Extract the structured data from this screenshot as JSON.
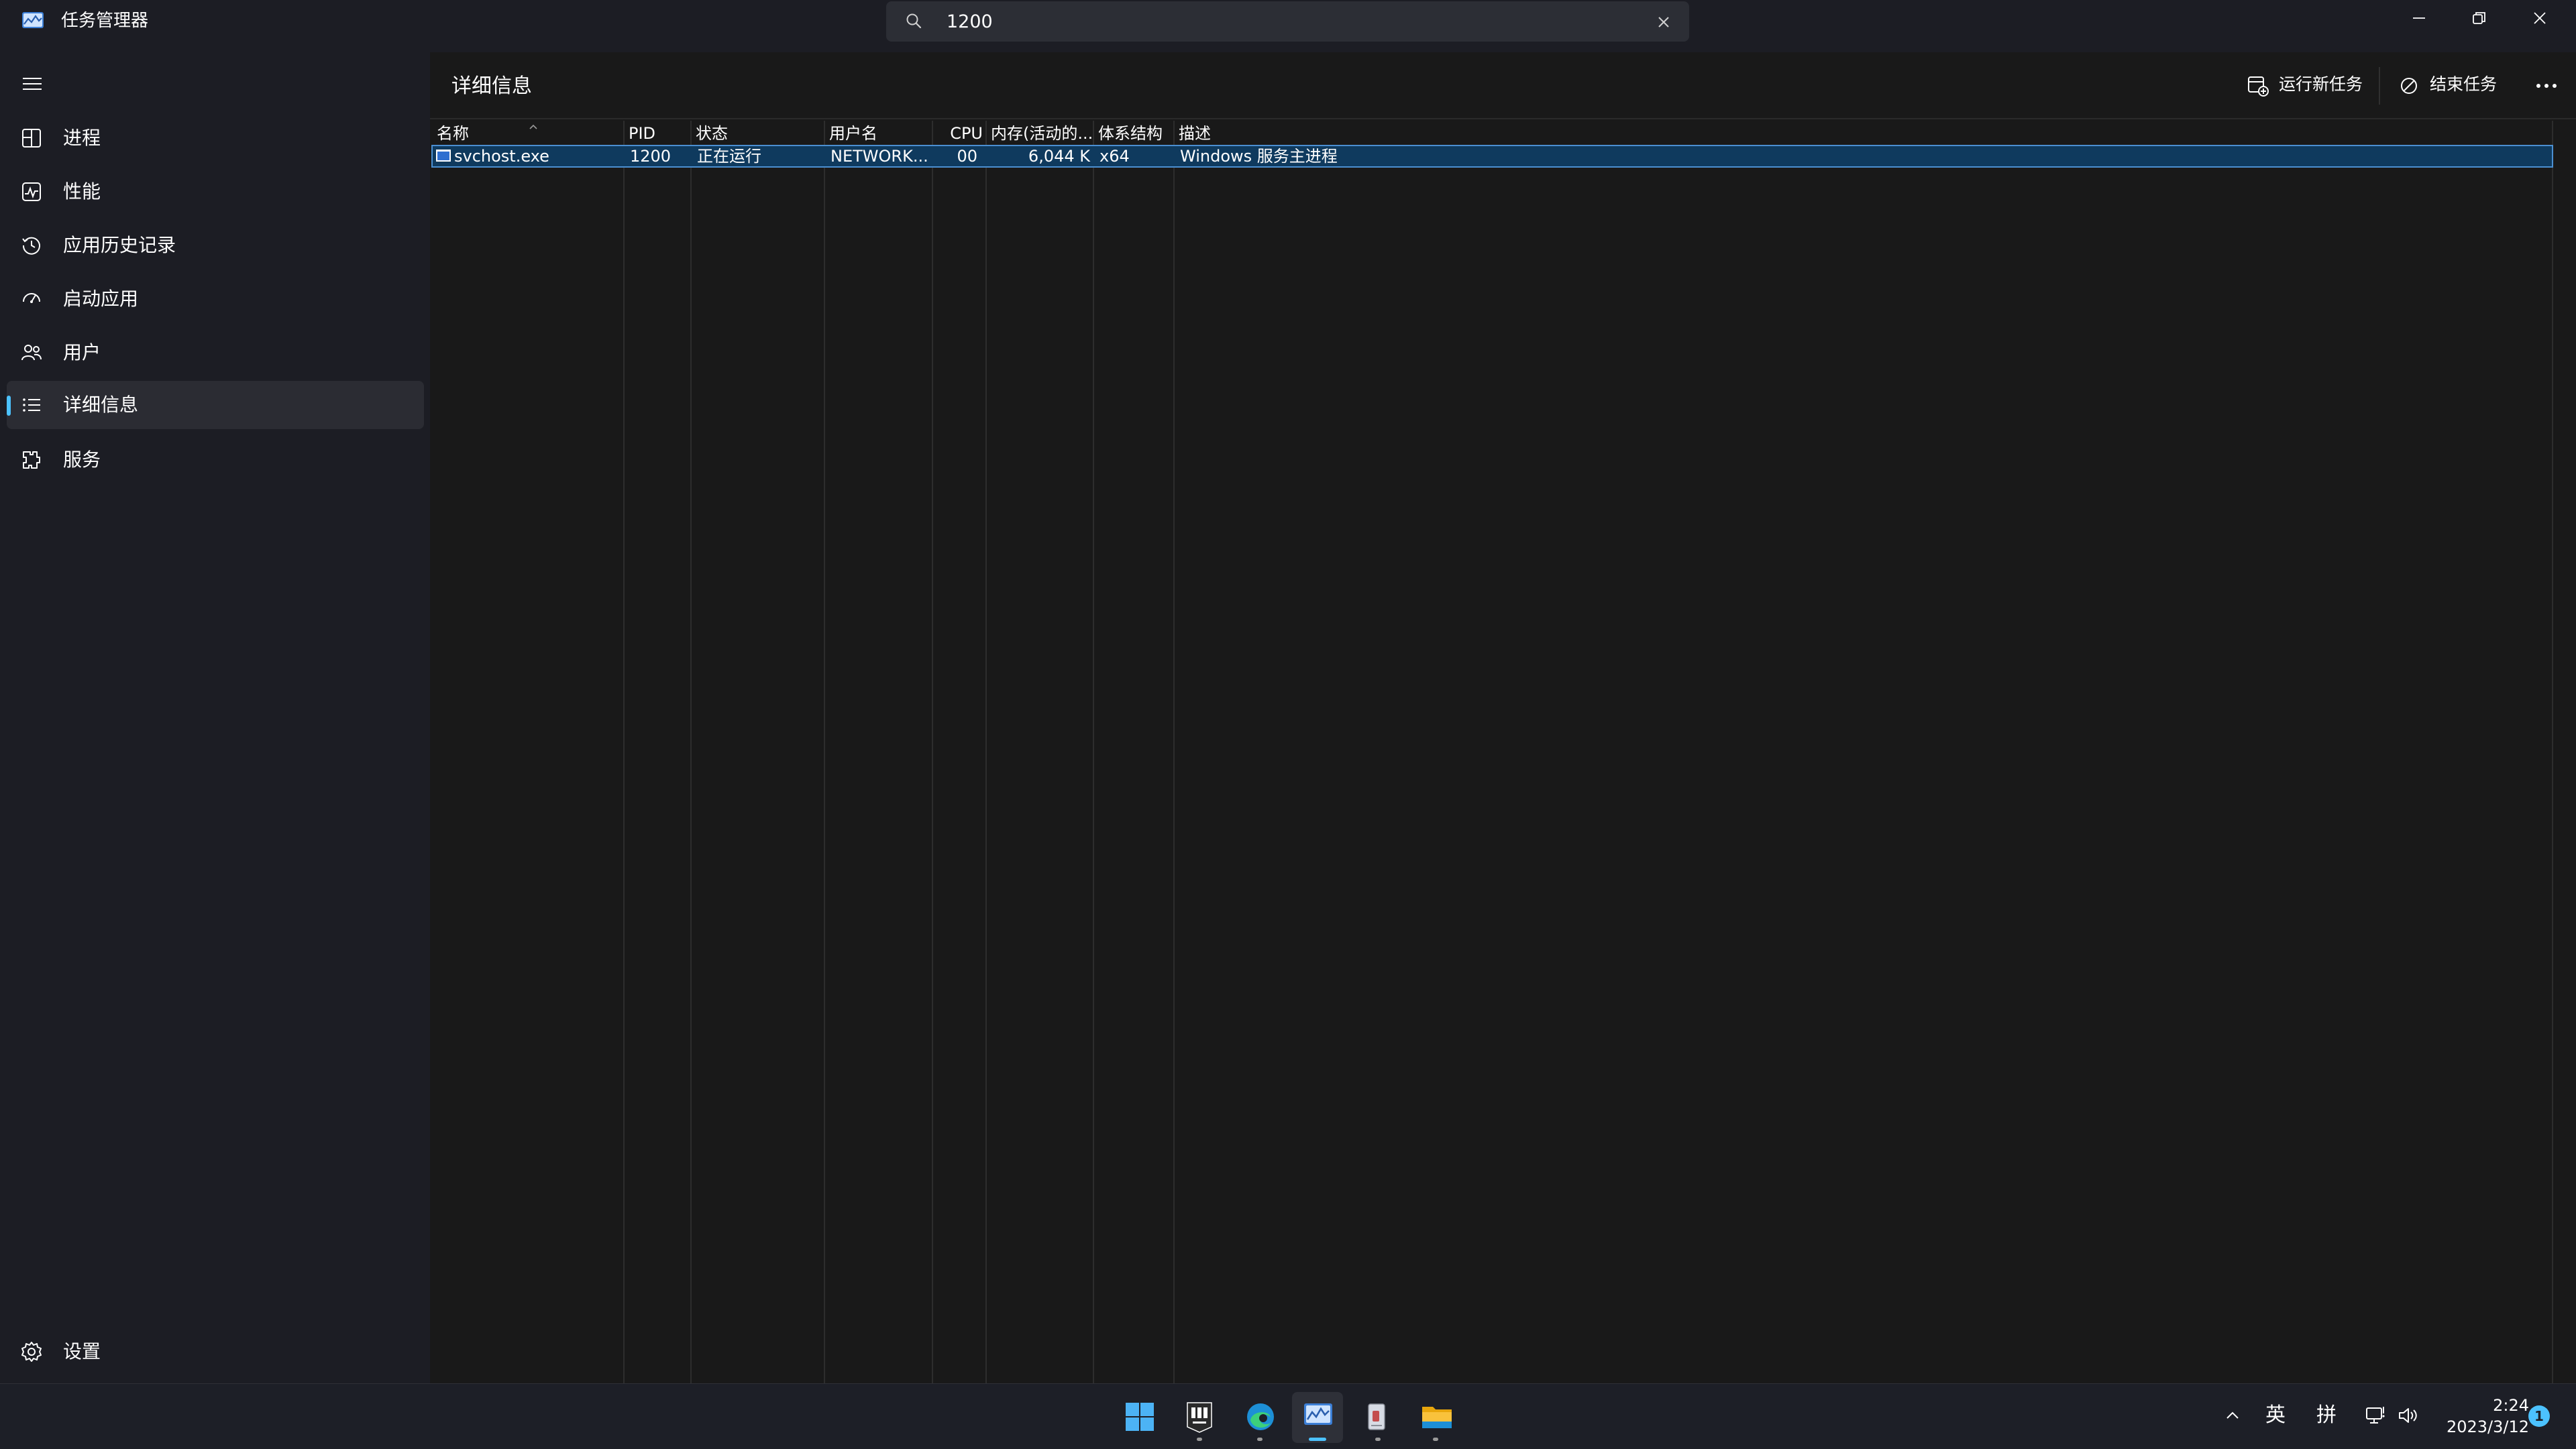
{
  "window": {
    "title": "任务管理器",
    "search": {
      "value": "1200",
      "placeholder": ""
    }
  },
  "sidebar": {
    "items": [
      {
        "label": "进程",
        "icon": "processes-icon",
        "active": false
      },
      {
        "label": "性能",
        "icon": "performance-icon",
        "active": false
      },
      {
        "label": "应用历史记录",
        "icon": "app-history-icon",
        "active": false
      },
      {
        "label": "启动应用",
        "icon": "startup-apps-icon",
        "active": false
      },
      {
        "label": "用户",
        "icon": "users-icon",
        "active": false
      },
      {
        "label": "详细信息",
        "icon": "details-icon",
        "active": true
      },
      {
        "label": "服务",
        "icon": "services-icon",
        "active": false
      }
    ],
    "settings_label": "设置"
  },
  "main": {
    "title": "详细信息",
    "commands": {
      "run_new_task": "运行新任务",
      "end_task": "结束任务"
    },
    "table": {
      "columns": [
        "名称",
        "PID",
        "状态",
        "用户名",
        "CPU",
        "内存(活动的...",
        "体系结构",
        "描述"
      ],
      "sorted_column": "名称",
      "rows": [
        {
          "name": "svchost.exe",
          "pid": "1200",
          "status": "正在运行",
          "user": "NETWORK...",
          "cpu": "00",
          "memory": "6,044 K",
          "arch": "x64",
          "description": "Windows 服务主进程"
        }
      ]
    }
  },
  "taskbar": {
    "apps": [
      "start-icon",
      "epic-games-icon",
      "edge-icon",
      "task-manager-icon",
      "notepad-icon",
      "file-explorer-icon"
    ],
    "active_app": "task-manager-icon",
    "tray": {
      "language": "英",
      "ime": "拼",
      "time": "2:24",
      "date": "2023/3/12",
      "notification_count": "1"
    }
  },
  "colors": {
    "accent": "#4cc2ff",
    "selection_bg": "#0f3a5e",
    "selection_border": "#4b8fd1",
    "sidebar_bg": "#1c1d24",
    "content_bg": "#191919"
  }
}
